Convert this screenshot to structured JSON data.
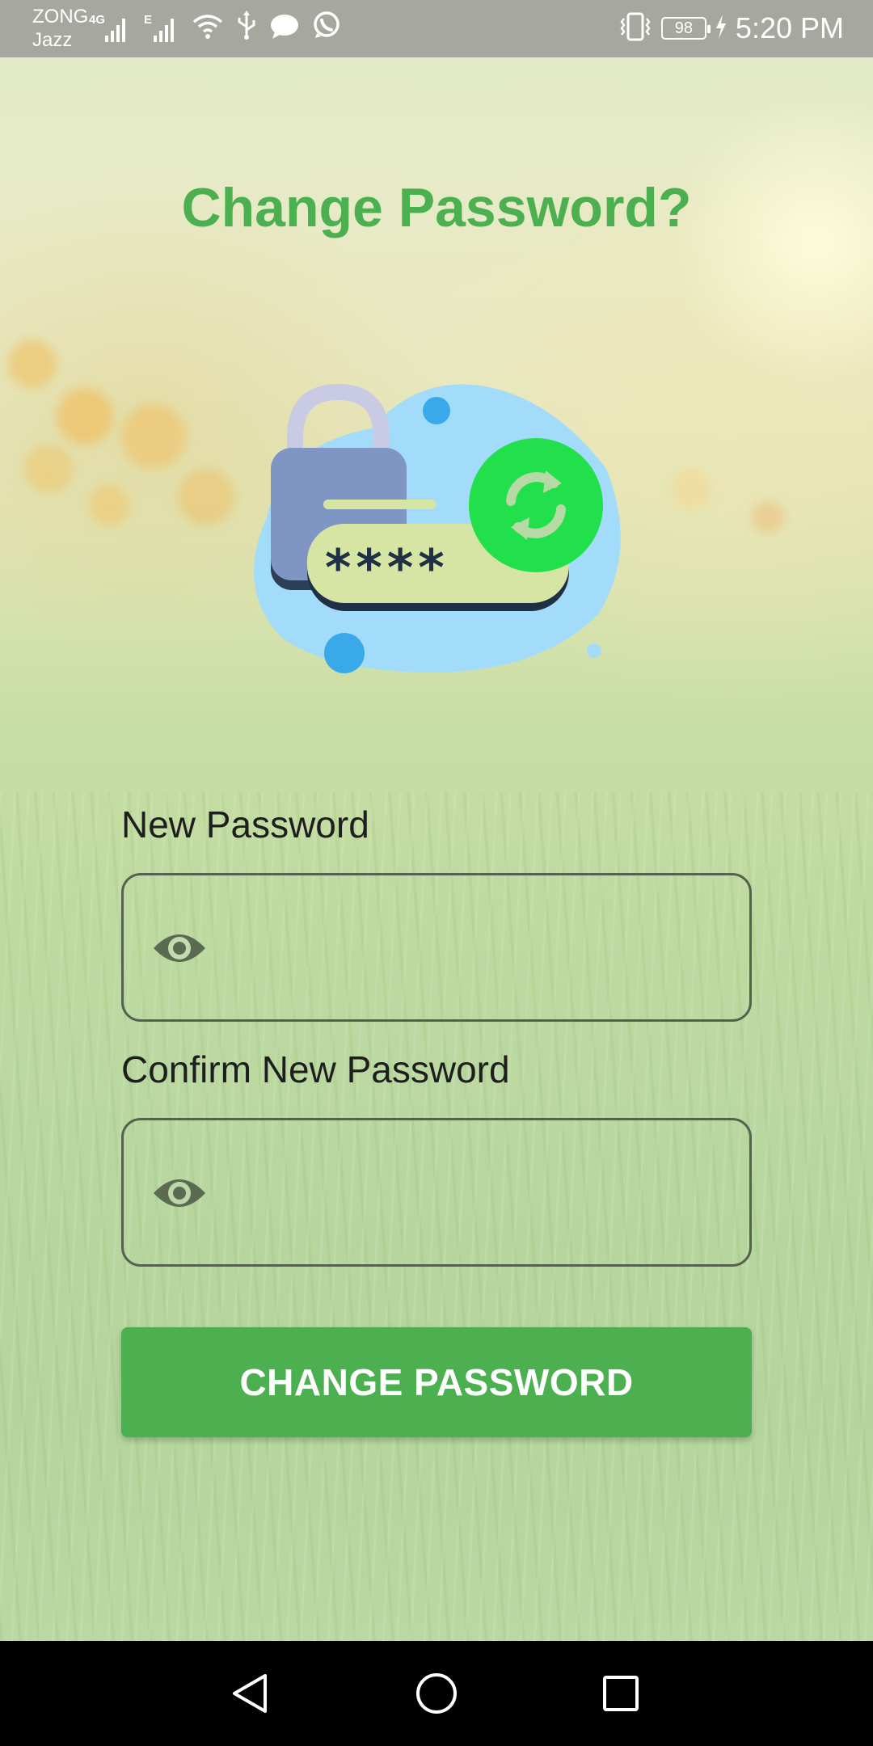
{
  "status_bar": {
    "carrier_line1": "ZONG",
    "carrier_line2": "Jazz",
    "network_badge_1": "4G",
    "network_badge_2": "E",
    "battery_level": "98",
    "time": "5:20 PM",
    "icons": [
      "signal-icon",
      "signal-icon",
      "wifi-icon",
      "usb-icon",
      "message-icon",
      "whatsapp-icon",
      "vibrate-icon",
      "battery-icon",
      "charging-icon"
    ]
  },
  "page": {
    "title": "Change Password?",
    "illustration_text": "****",
    "illustration_icons": [
      "padlock-icon",
      "refresh-icon"
    ]
  },
  "form": {
    "new_password": {
      "label": "New Password",
      "value": "",
      "icon": "eye-icon"
    },
    "confirm_password": {
      "label": "Confirm New Password",
      "value": "",
      "icon": "eye-icon"
    },
    "submit_label": "CHANGE PASSWORD"
  },
  "colors": {
    "accent": "#4caf50",
    "input_border": "#55624f",
    "illustration_blob": "#a3dcfb",
    "illustration_lock": "#7f95c4",
    "illustration_refresh": "#22e04c"
  },
  "nav_bar": {
    "buttons": [
      "back-icon",
      "home-icon",
      "recents-icon"
    ]
  }
}
